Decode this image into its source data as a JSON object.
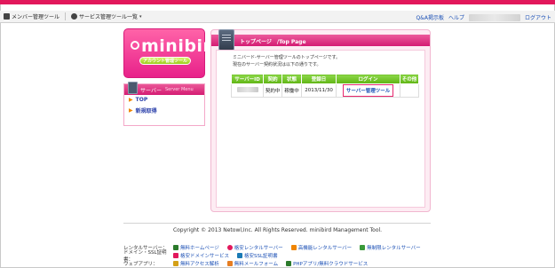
{
  "navbar": {
    "left": [
      {
        "label": "メンバー管理ツール",
        "icon": "member-tool-icon"
      },
      {
        "label": "サービス管理ツール一覧",
        "icon": "service-tool-icon",
        "caret": "▾"
      }
    ],
    "right": {
      "qa": "Q&A掲示板",
      "help": "ヘルプ",
      "logout": "ログアウト"
    }
  },
  "logo": {
    "text": "minibird",
    "badge": "アカウント管理ツール",
    "color": "#e8218a"
  },
  "sidebar": {
    "title": "サーバー",
    "subtitle": "Server Menu",
    "items": [
      {
        "label": "TOP"
      },
      {
        "label": "新規取得"
      }
    ]
  },
  "main": {
    "title": "トップページ　/Top Page",
    "desc_line1": "ミニバード-サーバー管理ツールのトップページです。",
    "desc_line2": "現在のサーバー契約状況は以下の通りです。",
    "table": {
      "headers": [
        "サーバーID",
        "契約",
        "状態",
        "登録日",
        "ログイン",
        "その他"
      ],
      "rows": [
        {
          "contract": "契約中",
          "status": "稼働中",
          "date": "2013/11/30",
          "login": "サーバー管理ツール",
          "other": ""
        }
      ]
    }
  },
  "footer": {
    "copyright": "Copyright © 2013 Netowl,Inc. All Rights Reserved. minibird Management Tool.",
    "rows": [
      {
        "label": "レンタルサーバー：",
        "links": [
          "無料ホームページ",
          "格安レンタルサーバー",
          "高機能レンタルサーバー",
          "無制限レンタルサーバー"
        ]
      },
      {
        "label": "ドメイン・SSL証明書：",
        "links": [
          "格安ドメインサービス",
          "格安SSL証明書"
        ]
      },
      {
        "label": "ウェブアプリ：",
        "links": [
          "無料アクセス解析",
          "無料メールフォーム",
          "PHPアプリ/無料クラウドサービス"
        ]
      }
    ]
  },
  "colors": {
    "brand": "#e2185c",
    "accent_green": "#5fb513",
    "link": "#1a4fb5"
  }
}
